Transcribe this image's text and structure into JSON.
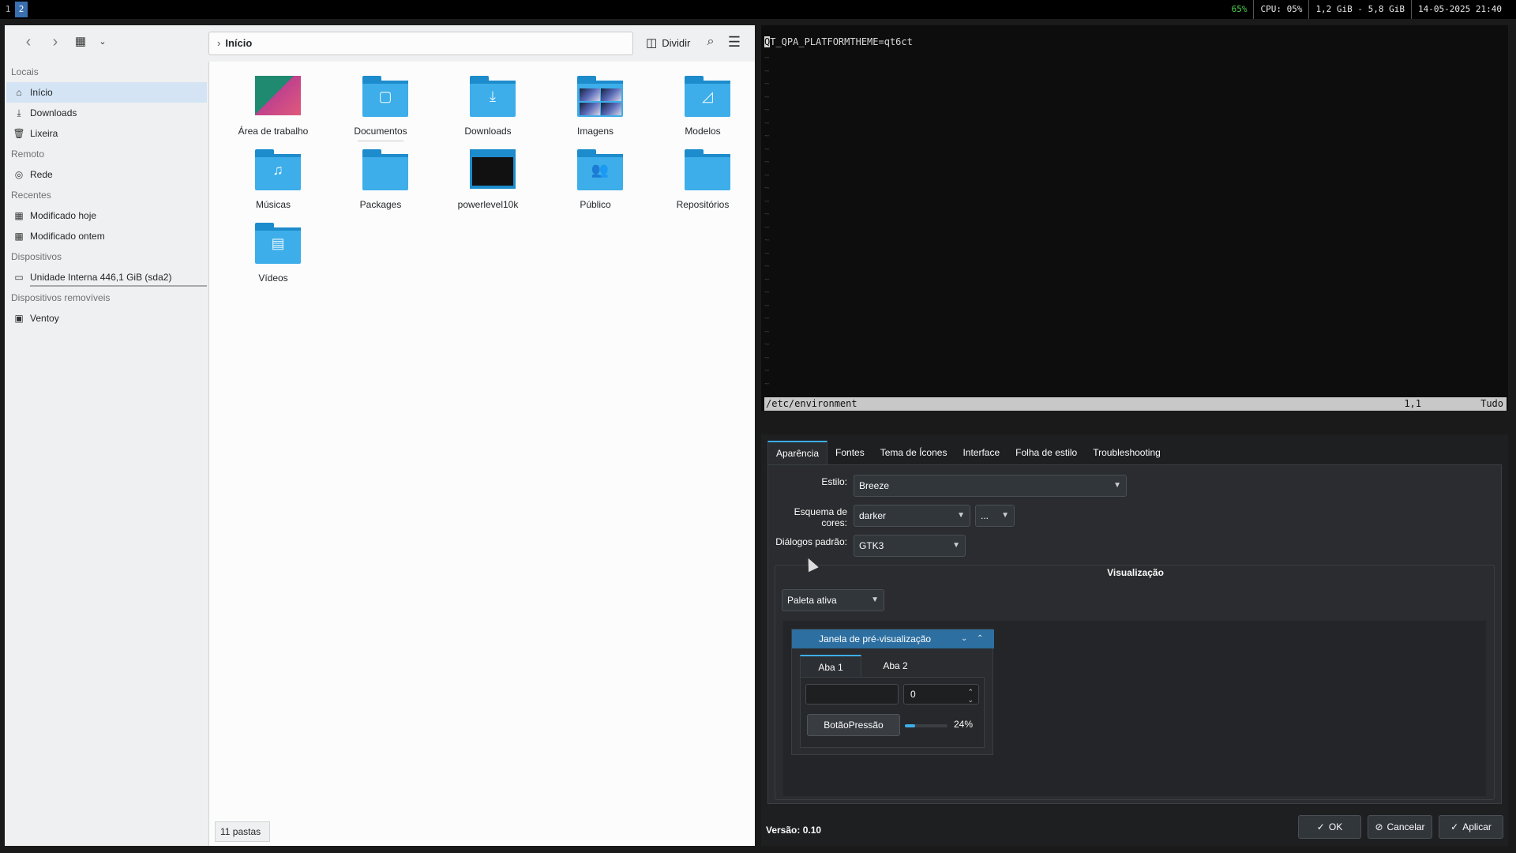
{
  "topbar": {
    "workspaces": [
      "1",
      "2"
    ],
    "battery": "65%",
    "cpu": "CPU: 05%",
    "memory": "1,2 GiB - 5,8 GiB",
    "datetime": "14-05-2025 21:40"
  },
  "dolphin": {
    "breadcrumb": "Início",
    "split_label": "Dividir",
    "places": {
      "sections": [
        "Locais",
        "Remoto",
        "Recentes",
        "Dispositivos",
        "Dispositivos removíveis"
      ],
      "locais": [
        "Início",
        "Downloads",
        "Lixeira"
      ],
      "remoto": [
        "Rede"
      ],
      "recentes": [
        "Modificado hoje",
        "Modificado ontem"
      ],
      "dispositivos": [
        "Unidade Interna 446,1 GiB (sda2)"
      ],
      "removiveis": [
        "Ventoy"
      ]
    },
    "files": [
      {
        "name": "Área de trabalho",
        "icon": "desktop-thumbnail"
      },
      {
        "name": "Documentos",
        "icon": "folder-documents-icon"
      },
      {
        "name": "Downloads",
        "icon": "folder-download-icon"
      },
      {
        "name": "Imagens",
        "icon": "folder-images-thumbnail"
      },
      {
        "name": "Modelos",
        "icon": "folder-templates-icon"
      },
      {
        "name": "Músicas",
        "icon": "folder-music-icon"
      },
      {
        "name": "Packages",
        "icon": "folder-icon"
      },
      {
        "name": "powerlevel10k",
        "icon": "folder-thumbnail"
      },
      {
        "name": "Público",
        "icon": "folder-public-icon"
      },
      {
        "name": "Repositórios",
        "icon": "folder-icon"
      },
      {
        "name": "Vídeos",
        "icon": "folder-videos-icon"
      }
    ],
    "status": "11 pastas"
  },
  "vim": {
    "line1": "QT_QPA_PLATFORMTHEME=qt6ct",
    "tilde": "~",
    "filename": "/etc/environment",
    "position": "1,1",
    "scroll": "Tudo"
  },
  "qt6ct": {
    "tabs": [
      "Aparência",
      "Fontes",
      "Tema de Ícones",
      "Interface",
      "Folha de estilo",
      "Troubleshooting"
    ],
    "style_label": "Estilo:",
    "style_value": "Breeze",
    "scheme_label": "Esquema de cores:",
    "scheme_value": "darker",
    "scheme_extra": "...",
    "dialogs_label": "Diálogos padrão:",
    "dialogs_value": "GTK3",
    "preview_title": "Visualização",
    "palette_value": "Paleta ativa",
    "preview_window_title": "Janela de pré-visualização",
    "preview_tab1": "Aba 1",
    "preview_tab2": "Aba 2",
    "spin_value": "0",
    "push_button": "BotãoPressão",
    "progress_percent": 24,
    "progress_label": "24%",
    "version": "Versão: 0.10",
    "ok": "OK",
    "cancel": "Cancelar",
    "apply": "Aplicar"
  }
}
